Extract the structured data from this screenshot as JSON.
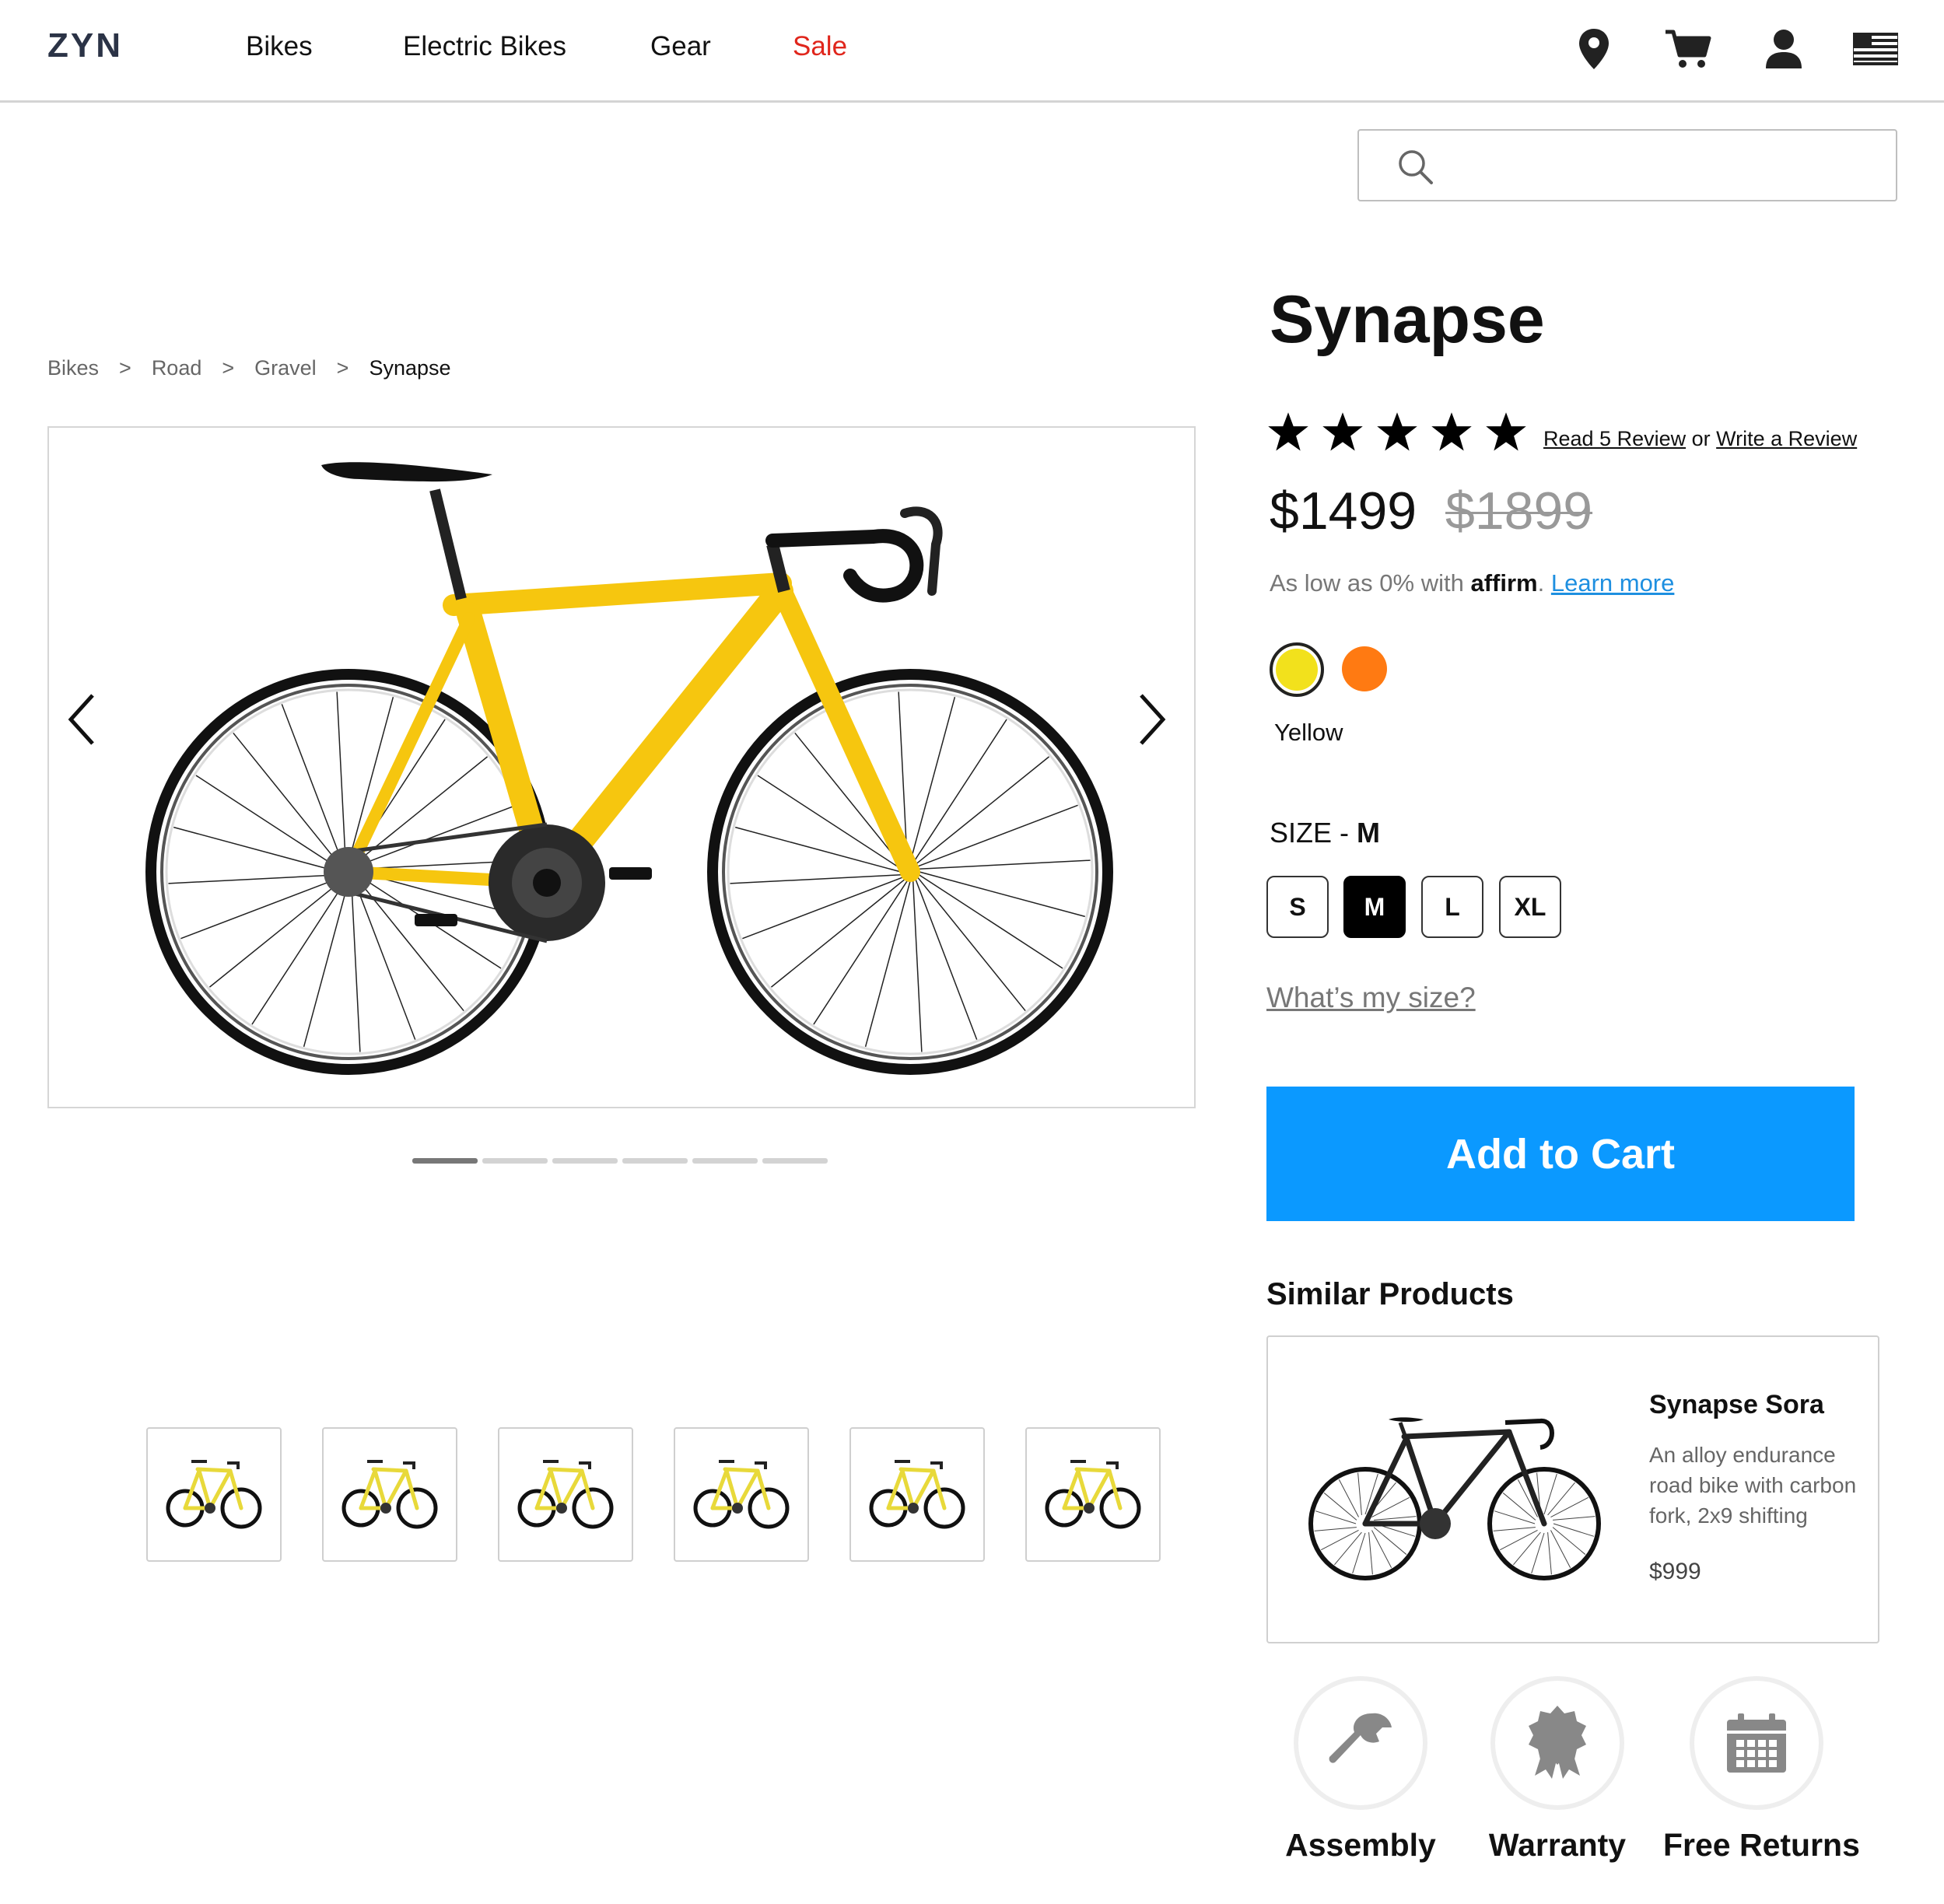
{
  "header": {
    "logo": "ZYN",
    "nav": [
      {
        "label": "Bikes"
      },
      {
        "label": "Electric Bikes"
      },
      {
        "label": "Gear"
      },
      {
        "label": "Sale"
      }
    ],
    "icons": [
      "location-pin-icon",
      "cart-icon",
      "user-icon",
      "us-flag-icon"
    ]
  },
  "search": {
    "placeholder": "",
    "icon": "search-icon"
  },
  "breadcrumb": [
    {
      "label": "Bikes"
    },
    {
      "label": "Road"
    },
    {
      "label": "Gravel"
    },
    {
      "label": "Synapse"
    }
  ],
  "breadcrumb_separator": ">",
  "gallery": {
    "image_count": 6,
    "active_index": 0,
    "prev_icon": "chevron-left-icon",
    "next_icon": "chevron-right-icon"
  },
  "product": {
    "title": "Synapse",
    "rating": 5,
    "rating_max": 5,
    "read_reviews_link": "Read 5 Review",
    "or_text": "or",
    "write_review_link": "Write a Review",
    "price": "$1499",
    "old_price": "$1899",
    "financing": {
      "prefix": "As low as 0% with",
      "brand": "affirm",
      "suffix": ".",
      "link": "Learn more"
    },
    "colors": [
      {
        "name": "Yellow",
        "hex": "#f2e11c",
        "selected": true
      },
      {
        "name": "Orange",
        "hex": "#ff7a12",
        "selected": false
      }
    ],
    "selected_color_label": "Yellow",
    "size_label": "SIZE - ",
    "selected_size": "M",
    "sizes": [
      "S",
      "M",
      "L",
      "XL"
    ],
    "size_help_link": "What’s my size?",
    "add_to_cart": "Add to Cart",
    "accent_color": "#0b99ff",
    "sale_color": "#e0261c"
  },
  "similar": {
    "title": "Similar Products",
    "items": [
      {
        "name": "Synapse Sora",
        "description": "An alloy endurance road bike with carbon fork, 2x9  shifting",
        "price": "$999"
      }
    ]
  },
  "features": [
    {
      "label": "Assembly",
      "icon": "wrench-icon"
    },
    {
      "label": "Warranty",
      "icon": "badge-icon"
    },
    {
      "label": "Free Returns",
      "icon": "calendar-icon"
    }
  ]
}
